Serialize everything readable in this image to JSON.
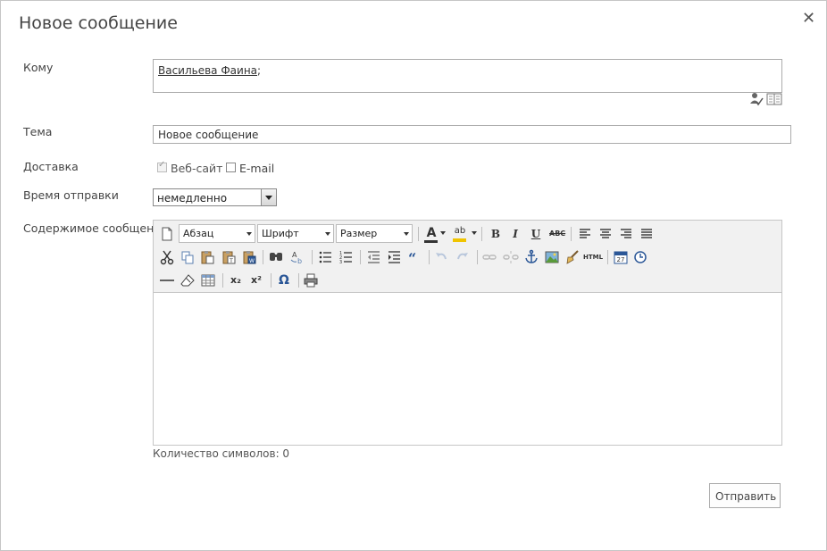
{
  "dialog": {
    "title": "Новое сообщение",
    "close_glyph": "✕"
  },
  "form": {
    "to_label": "Кому",
    "to_recipient": "Васильева Фаина",
    "to_separator": ";",
    "subject_label": "Тема",
    "subject_value": "Новое сообщение",
    "delivery_label": "Доставка",
    "delivery_options": [
      {
        "label": "Веб-сайт",
        "checked": true,
        "disabled": true
      },
      {
        "label": "E-mail",
        "checked": false,
        "disabled": false
      }
    ],
    "send_time_label": "Время отправки",
    "send_time_value": "немедленно",
    "content_label": "Содержимое сообщения"
  },
  "toolbar": {
    "paragraph_dd": "Абзац",
    "font_dd": "Шрифт",
    "size_dd": "Размер",
    "bold": "B",
    "italic": "I",
    "underline": "U",
    "strikethrough": "ABC",
    "html_source": "HTML",
    "calendar_day": "27",
    "subscript": "x₂",
    "superscript": "x²",
    "special_char": "Ω",
    "highlight_color": "ab",
    "font_color": "A"
  },
  "footer": {
    "char_count": "Количество символов: 0",
    "send_label": "Отправить"
  }
}
